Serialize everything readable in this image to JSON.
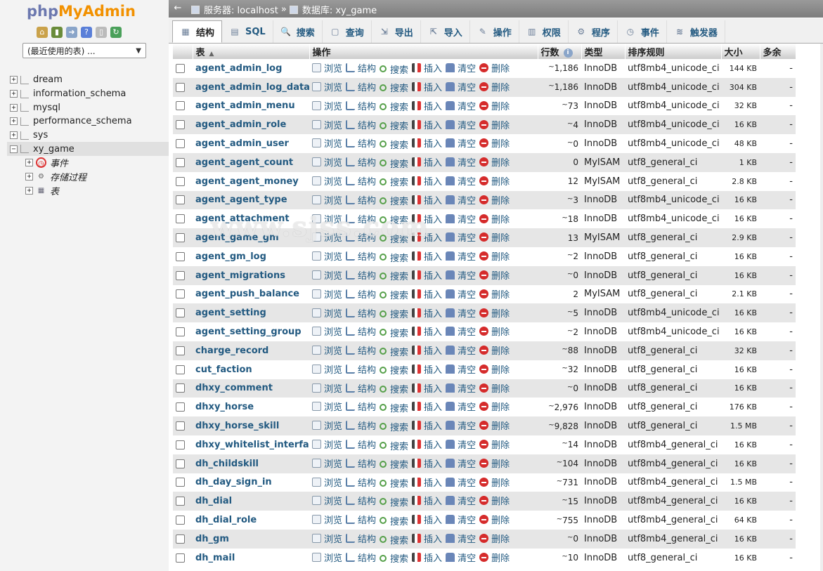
{
  "sidebar": {
    "logo_php": "php",
    "logo_admin": "MyAdmin",
    "icons": [
      {
        "name": "home-icon",
        "glyph": "⌂",
        "color": "#caa24a"
      },
      {
        "name": "logout-icon",
        "glyph": "▮",
        "color": "#6a8c3a"
      },
      {
        "name": "query-icon",
        "glyph": "➜",
        "color": "#8aa5c9"
      },
      {
        "name": "help-icon",
        "glyph": "?",
        "color": "#5a7fd8"
      },
      {
        "name": "docs-icon",
        "glyph": "▯",
        "color": "#bbbbbb"
      },
      {
        "name": "reload-icon",
        "glyph": "↻",
        "color": "#4aa05a"
      }
    ],
    "recent_select": "(最近使用的表) ...",
    "databases": [
      "dream",
      "information_schema",
      "mysql",
      "performance_schema",
      "sys",
      "xy_game"
    ],
    "active_db_children": [
      "事件",
      "存储过程",
      "表"
    ]
  },
  "topbar": {
    "server_label": "服务器: localhost",
    "separator": "»",
    "db_label": "数据库: xy_game"
  },
  "tabs": [
    {
      "label": "结构",
      "icon": "structure-icon",
      "glyph": "▦"
    },
    {
      "label": "SQL",
      "icon": "sql-icon",
      "glyph": "▤"
    },
    {
      "label": "搜索",
      "icon": "search-icon",
      "glyph": "🔍"
    },
    {
      "label": "查询",
      "icon": "query-icon",
      "glyph": "▢"
    },
    {
      "label": "导出",
      "icon": "export-icon",
      "glyph": "⇲"
    },
    {
      "label": "导入",
      "icon": "import-icon",
      "glyph": "⇱"
    },
    {
      "label": "操作",
      "icon": "operations-icon",
      "glyph": "✎"
    },
    {
      "label": "权限",
      "icon": "privileges-icon",
      "glyph": "▥"
    },
    {
      "label": "程序",
      "icon": "routines-icon",
      "glyph": "⚙"
    },
    {
      "label": "事件",
      "icon": "events-icon",
      "glyph": "◷"
    },
    {
      "label": "触发器",
      "icon": "triggers-icon",
      "glyph": "≋"
    }
  ],
  "table": {
    "headers": {
      "name": "表",
      "actions": "操作",
      "rows": "行数",
      "type": "类型",
      "collation": "排序规则",
      "size": "大小",
      "overhead": "多余"
    },
    "action_labels": {
      "browse": "浏览",
      "structure": "结构",
      "search": "搜索",
      "insert": "插入",
      "empty": "清空",
      "drop": "删除"
    },
    "rows": [
      {
        "name": "agent_admin_log",
        "rows": "1,186",
        "approx": true,
        "type": "InnoDB",
        "collation": "utf8mb4_unicode_ci",
        "size": "144 KB",
        "overhead": "-"
      },
      {
        "name": "agent_admin_log_data",
        "rows": "1,186",
        "approx": true,
        "type": "InnoDB",
        "collation": "utf8mb4_unicode_ci",
        "size": "304 KB",
        "overhead": "-"
      },
      {
        "name": "agent_admin_menu",
        "rows": "73",
        "approx": true,
        "type": "InnoDB",
        "collation": "utf8mb4_unicode_ci",
        "size": "32 KB",
        "overhead": "-"
      },
      {
        "name": "agent_admin_role",
        "rows": "4",
        "approx": true,
        "type": "InnoDB",
        "collation": "utf8mb4_unicode_ci",
        "size": "16 KB",
        "overhead": "-"
      },
      {
        "name": "agent_admin_user",
        "rows": "0",
        "approx": true,
        "type": "InnoDB",
        "collation": "utf8mb4_unicode_ci",
        "size": "48 KB",
        "overhead": "-"
      },
      {
        "name": "agent_agent_count",
        "rows": "0",
        "approx": false,
        "type": "MyISAM",
        "collation": "utf8_general_ci",
        "size": "1 KB",
        "overhead": "-"
      },
      {
        "name": "agent_agent_money",
        "rows": "12",
        "approx": false,
        "type": "MyISAM",
        "collation": "utf8_general_ci",
        "size": "2.8 KB",
        "overhead": "-"
      },
      {
        "name": "agent_agent_type",
        "rows": "3",
        "approx": true,
        "type": "InnoDB",
        "collation": "utf8mb4_unicode_ci",
        "size": "16 KB",
        "overhead": "-"
      },
      {
        "name": "agent_attachment",
        "rows": "18",
        "approx": true,
        "type": "InnoDB",
        "collation": "utf8mb4_unicode_ci",
        "size": "16 KB",
        "overhead": "-"
      },
      {
        "name": "agent_game_gm",
        "rows": "13",
        "approx": false,
        "type": "MyISAM",
        "collation": "utf8_general_ci",
        "size": "2.9 KB",
        "overhead": "-"
      },
      {
        "name": "agent_gm_log",
        "rows": "2",
        "approx": true,
        "type": "InnoDB",
        "collation": "utf8_general_ci",
        "size": "16 KB",
        "overhead": "-"
      },
      {
        "name": "agent_migrations",
        "rows": "0",
        "approx": true,
        "type": "InnoDB",
        "collation": "utf8_general_ci",
        "size": "16 KB",
        "overhead": "-"
      },
      {
        "name": "agent_push_balance",
        "rows": "2",
        "approx": false,
        "type": "MyISAM",
        "collation": "utf8_general_ci",
        "size": "2.1 KB",
        "overhead": "-"
      },
      {
        "name": "agent_setting",
        "rows": "5",
        "approx": true,
        "type": "InnoDB",
        "collation": "utf8mb4_unicode_ci",
        "size": "16 KB",
        "overhead": "-"
      },
      {
        "name": "agent_setting_group",
        "rows": "2",
        "approx": true,
        "type": "InnoDB",
        "collation": "utf8mb4_unicode_ci",
        "size": "16 KB",
        "overhead": "-"
      },
      {
        "name": "charge_record",
        "rows": "88",
        "approx": true,
        "type": "InnoDB",
        "collation": "utf8_general_ci",
        "size": "32 KB",
        "overhead": "-"
      },
      {
        "name": "cut_faction",
        "rows": "32",
        "approx": true,
        "type": "InnoDB",
        "collation": "utf8_general_ci",
        "size": "16 KB",
        "overhead": "-"
      },
      {
        "name": "dhxy_comment",
        "rows": "0",
        "approx": true,
        "type": "InnoDB",
        "collation": "utf8_general_ci",
        "size": "16 KB",
        "overhead": "-"
      },
      {
        "name": "dhxy_horse",
        "rows": "2,976",
        "approx": true,
        "type": "InnoDB",
        "collation": "utf8_general_ci",
        "size": "176 KB",
        "overhead": "-"
      },
      {
        "name": "dhxy_horse_skill",
        "rows": "9,828",
        "approx": true,
        "type": "InnoDB",
        "collation": "utf8_general_ci",
        "size": "1.5 MB",
        "overhead": "-"
      },
      {
        "name": "dhxy_whitelist_interface",
        "rows": "14",
        "approx": true,
        "type": "InnoDB",
        "collation": "utf8mb4_general_ci",
        "size": "16 KB",
        "overhead": "-"
      },
      {
        "name": "dh_childskill",
        "rows": "104",
        "approx": true,
        "type": "InnoDB",
        "collation": "utf8mb4_general_ci",
        "size": "16 KB",
        "overhead": "-"
      },
      {
        "name": "dh_day_sign_in",
        "rows": "731",
        "approx": true,
        "type": "InnoDB",
        "collation": "utf8mb4_general_ci",
        "size": "1.5 MB",
        "overhead": "-"
      },
      {
        "name": "dh_dial",
        "rows": "15",
        "approx": true,
        "type": "InnoDB",
        "collation": "utf8mb4_general_ci",
        "size": "16 KB",
        "overhead": "-"
      },
      {
        "name": "dh_dial_role",
        "rows": "755",
        "approx": true,
        "type": "InnoDB",
        "collation": "utf8mb4_general_ci",
        "size": "64 KB",
        "overhead": "-"
      },
      {
        "name": "dh_gm",
        "rows": "0",
        "approx": true,
        "type": "InnoDB",
        "collation": "utf8mb4_general_ci",
        "size": "16 KB",
        "overhead": "-"
      },
      {
        "name": "dh_mail",
        "rows": "10",
        "approx": true,
        "type": "InnoDB",
        "collation": "utf8_general_ci",
        "size": "16 KB",
        "overhead": "-"
      }
    ]
  },
  "watermark": "www.sjss.com"
}
